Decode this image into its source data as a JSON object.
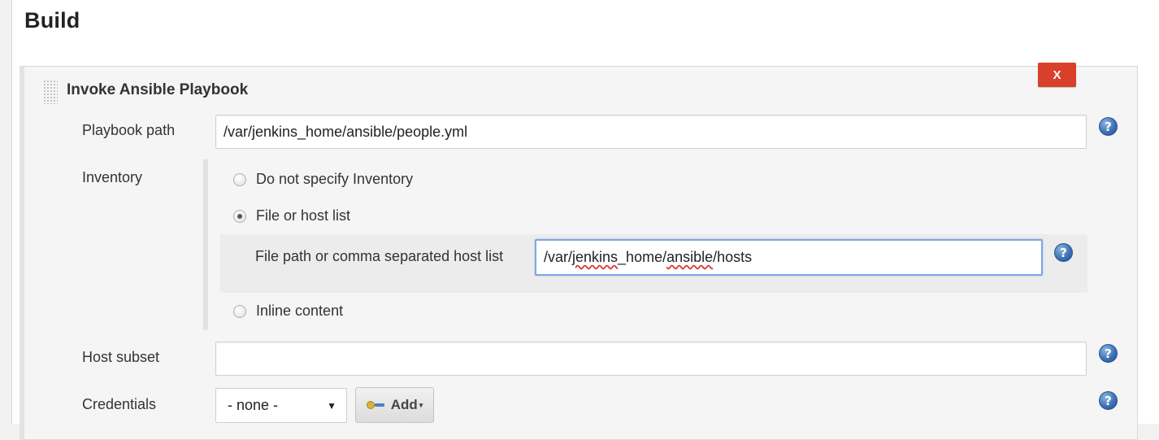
{
  "section": {
    "title": "Build"
  },
  "step": {
    "title": "Invoke Ansible Playbook",
    "delete_label": "X"
  },
  "fields": {
    "playbook_path": {
      "label": "Playbook path",
      "value": "/var/jenkins_home/ansible/people.yml"
    },
    "inventory": {
      "label": "Inventory",
      "options": [
        {
          "label": "Do not specify Inventory",
          "checked": false
        },
        {
          "label": "File or host list",
          "checked": true
        },
        {
          "label": "Inline content",
          "checked": false
        }
      ],
      "file_path": {
        "label": "File path or comma separated host list",
        "value_parts": [
          "/var/",
          "jenkins",
          "_home/",
          "ansible",
          "/hosts"
        ]
      }
    },
    "host_subset": {
      "label": "Host subset",
      "value": ""
    },
    "credentials": {
      "label": "Credentials",
      "selected": "- none -",
      "add_label": "Add"
    }
  },
  "help_icon": "?",
  "colors": {
    "delete_button": "#d9402b",
    "help_icon": "#3d73b7",
    "focus_border": "#7aa7e0"
  },
  "icons": {
    "drag": "drag-handle-icon",
    "help": "help-icon",
    "key": "key-icon",
    "select_caret": "chevron-down-icon"
  }
}
